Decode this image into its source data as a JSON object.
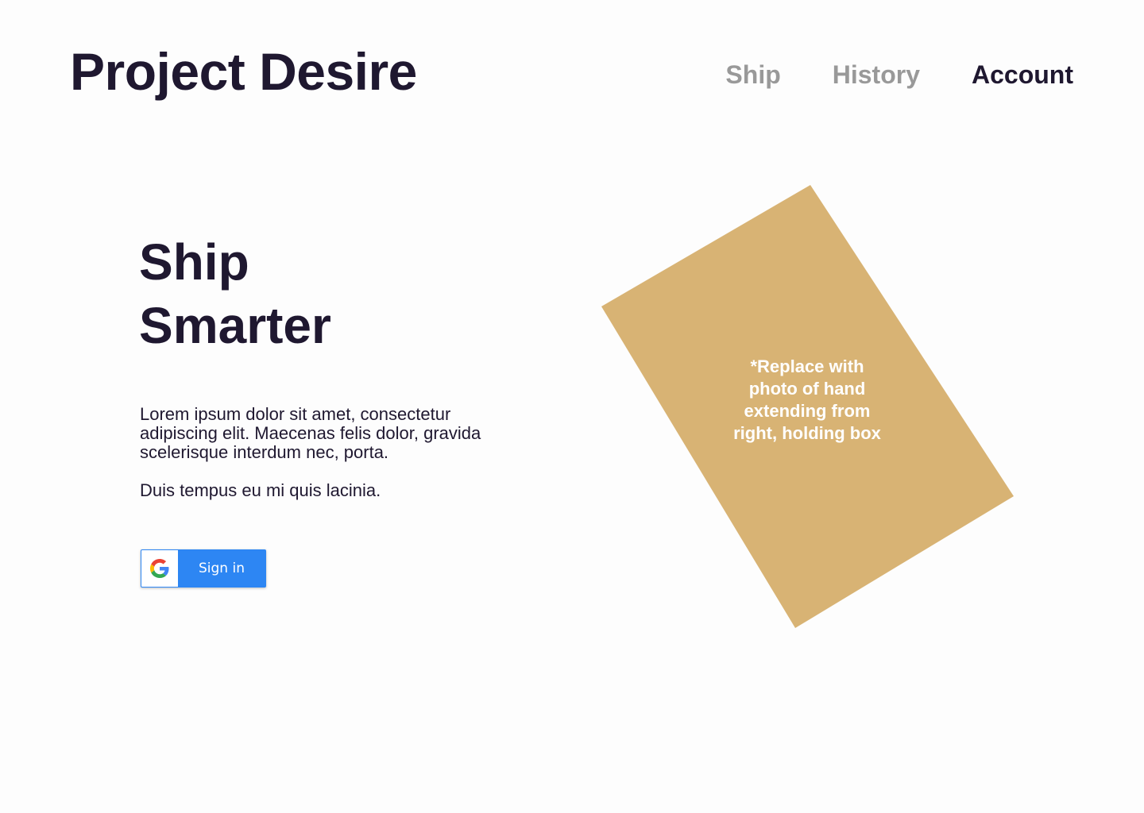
{
  "header": {
    "brand": "Project Desire",
    "nav": [
      {
        "label": "Ship",
        "active": false
      },
      {
        "label": "History",
        "active": false
      },
      {
        "label": "Account",
        "active": true
      }
    ]
  },
  "hero": {
    "title_line1": "Ship",
    "title_line2": "Smarter",
    "paragraph1": "Lorem ipsum dolor sit amet, consectetur adipiscing elit. Maecenas felis dolor, gravida scelerisque interdum nec, porta.",
    "paragraph2": "Duis tempus eu mi quis lacinia.",
    "signin_label": "Sign in",
    "signin_icon": "google-g-icon"
  },
  "image_placeholder": {
    "note": "*Replace with photo of hand extending from right, holding box"
  },
  "colors": {
    "background": "#fdfdfd",
    "text_dark": "#1f1830",
    "nav_muted": "#999999",
    "button_blue": "#2d86f3",
    "placeholder_gold": "#d8b374"
  }
}
